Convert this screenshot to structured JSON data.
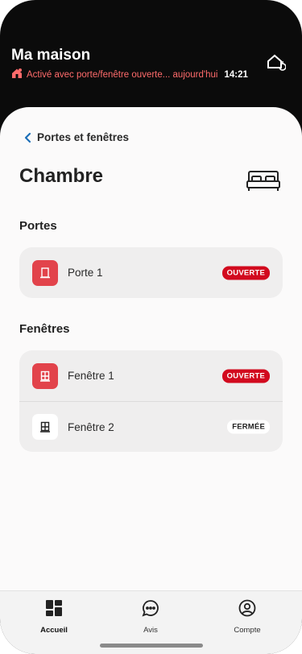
{
  "header": {
    "title": "Ma maison",
    "status_text": "Activé avec porte/fenêtre ouverte... aujourd'hui",
    "status_time": "14:21",
    "accent_color": "#ff6b6b"
  },
  "nav": {
    "back_label": "Portes et fenêtres"
  },
  "room": {
    "title": "Chambre",
    "icon": "bed-icon"
  },
  "sections": {
    "doors": {
      "title": "Portes",
      "items": [
        {
          "label": "Porte 1",
          "status": "OUVERTE",
          "state": "open"
        }
      ]
    },
    "windows": {
      "title": "Fenêtres",
      "items": [
        {
          "label": "Fenêtre 1",
          "status": "OUVERTE",
          "state": "open"
        },
        {
          "label": "Fenêtre 2",
          "status": "FERMÉE",
          "state": "closed"
        }
      ]
    }
  },
  "tabbar": {
    "tabs": [
      {
        "label": "Accueil",
        "icon": "dashboard-icon",
        "active": true
      },
      {
        "label": "Avis",
        "icon": "chat-bubble-icon",
        "active": false
      },
      {
        "label": "Compte",
        "icon": "user-circle-icon",
        "active": false
      }
    ]
  },
  "colors": {
    "open_badge": "#d20a1e",
    "icon_red": "#e2434b",
    "header_bg": "#0b0b0b"
  }
}
